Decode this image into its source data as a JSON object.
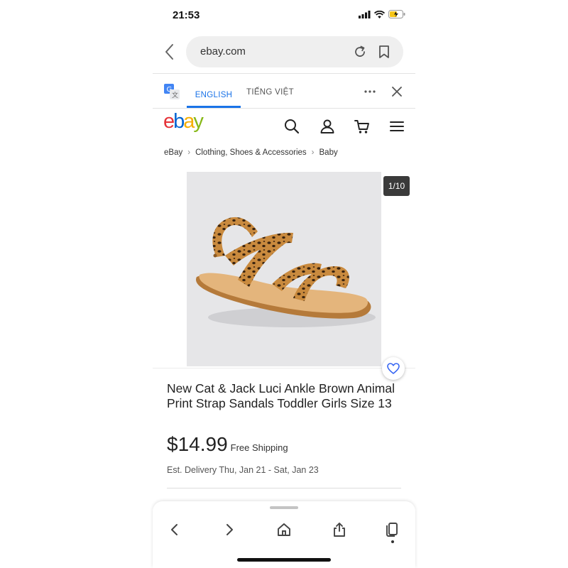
{
  "status_bar": {
    "time": "21:53",
    "battery_color": "#f5c518"
  },
  "browser": {
    "url": "ebay.com"
  },
  "translate_bar": {
    "tab_active": "ENGLISH",
    "tab_other": "TIẾNG VIỆT",
    "accent_color": "#1a73e8"
  },
  "ebay_logo": {
    "e": "e",
    "b": "b",
    "a": "a",
    "y": "y"
  },
  "breadcrumb": [
    "eBay",
    "Clothing, Shoes & Accessories",
    "Baby"
  ],
  "gallery": {
    "counter": "1/10"
  },
  "product": {
    "title": "New Cat & Jack Luci Ankle Brown Animal Print Strap Sandals Toddler Girls Size 13",
    "price": "$14.99",
    "shipping": "Free Shipping",
    "delivery": "Est. Delivery Thu, Jan 21 - Sat, Jan 23"
  },
  "icons": {
    "header": [
      "search-icon",
      "account-icon",
      "cart-icon",
      "menu-icon"
    ],
    "toolbar": [
      "back-arrow-icon",
      "forward-arrow-icon",
      "home-icon",
      "share-icon",
      "tabs-icon"
    ]
  }
}
